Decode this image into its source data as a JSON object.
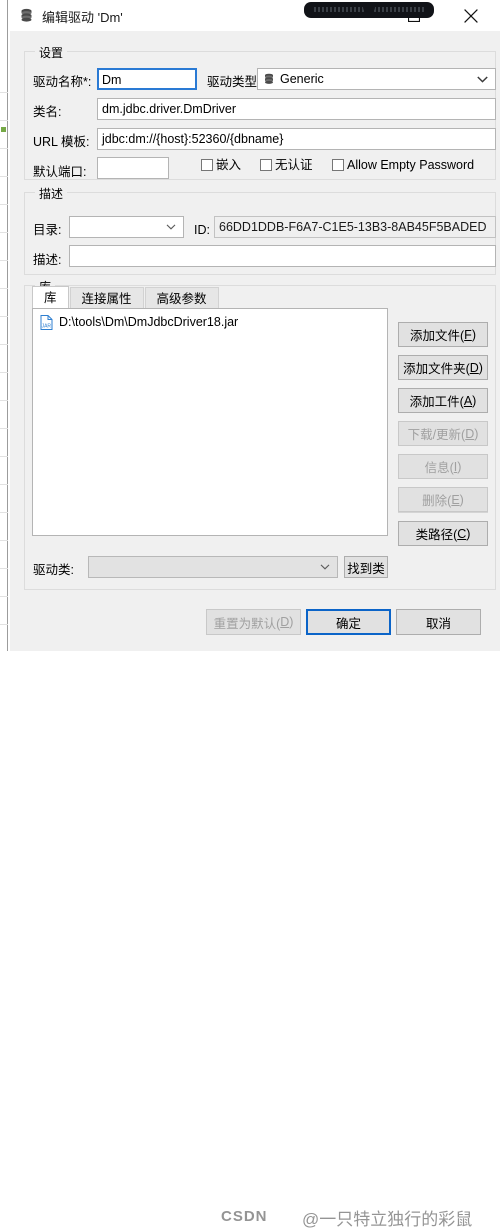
{
  "window": {
    "title": "编辑驱动 'Dm'",
    "icon": "database-icon",
    "maximize_icon": "maximize-icon",
    "close_icon": "close-icon"
  },
  "settings_group": {
    "legend": "设置",
    "driver_name_label": "驱动名称*:",
    "driver_name_value": "Dm",
    "driver_type_label": "驱动类型:",
    "driver_type_value": "Generic",
    "class_name_label": "类名:",
    "class_name_value": "dm.jdbc.driver.DmDriver",
    "url_template_label": "URL 模板:",
    "url_template_value": "jdbc:dm://{host}:52360/{dbname}",
    "default_port_label": "默认端口:",
    "default_port_value": "",
    "checkboxes": [
      {
        "label": "嵌入",
        "checked": false
      },
      {
        "label": "无认证",
        "checked": false
      },
      {
        "label": "Allow Empty Password",
        "checked": false
      }
    ]
  },
  "description_group": {
    "legend": "描述",
    "category_label": "目录:",
    "category_value": "",
    "id_label": "ID:",
    "id_value": "66DD1DDB-F6A7-C1E5-13B3-8AB45F5BADED",
    "description_label": "描述:",
    "description_value": ""
  },
  "library_group": {
    "legend": "库",
    "tabs": [
      {
        "label": "库",
        "active": true
      },
      {
        "label": "连接属性",
        "active": false
      },
      {
        "label": "高级参数",
        "active": false
      }
    ],
    "files": [
      {
        "name": "D:\\tools\\Dm\\DmJdbcDriver18.jar",
        "icon": "jar-file-icon"
      }
    ],
    "buttons": [
      {
        "label": "添加文件(F)",
        "mnemonic": "F",
        "text": "添加文件(",
        "enabled": true
      },
      {
        "label": "添加文件夹(D)",
        "mnemonic": "D",
        "text": "添加文件夹(",
        "enabled": true
      },
      {
        "label": "添加工件(A)",
        "mnemonic": "A",
        "text": "添加工件(",
        "enabled": true
      },
      {
        "label": "下载/更新(D)",
        "mnemonic": "D",
        "text": "下载/更新(",
        "enabled": false
      },
      {
        "label": "信息(I)",
        "mnemonic": "I",
        "text": "信息(",
        "enabled": false
      },
      {
        "label": "删除(E)",
        "mnemonic": "E",
        "text": "删除(",
        "enabled": false
      },
      {
        "label": "类路径(C)",
        "mnemonic": "C",
        "text": "类路径(",
        "enabled": true
      }
    ],
    "driver_class_label": "驱动类:",
    "driver_class_value": "",
    "find_class_label": "找到类"
  },
  "bottom_bar": {
    "reset_text": "重置为默认(",
    "reset_mnemonic": "D",
    "ok_label": "确定",
    "cancel_label": "取消"
  },
  "watermark": {
    "site": "CSDN",
    "handle": "@一只特立独行的彩鼠"
  },
  "colors": {
    "accent": "#2a7ad4",
    "default_button_border": "#0b64c8",
    "dialog_bg": "#f0f0f0",
    "group_border": "#dcdcdc",
    "icon_blue": "#2f7fd0",
    "disabled_text": "#a0a0a0"
  }
}
